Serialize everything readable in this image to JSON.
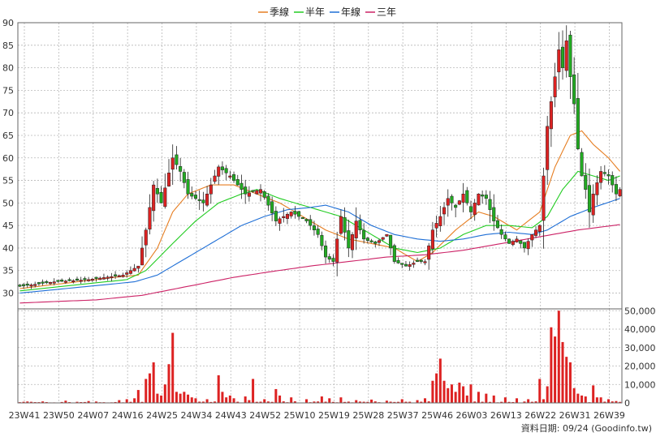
{
  "legend": [
    {
      "label": "季線",
      "color": "#e67e22"
    },
    {
      "label": "半年",
      "color": "#22cc22"
    },
    {
      "label": "年線",
      "color": "#1f6fd6"
    },
    {
      "label": "三年",
      "color": "#cc2266"
    }
  ],
  "source_label": "資料日期: 09/24  (Goodinfo.tw)",
  "colors": {
    "up": "#dd2222",
    "down": "#22aa22",
    "volume": "#dd2222",
    "grid": "#b8b8b8"
  },
  "chart_data": [
    {
      "type": "candlestick",
      "title": "",
      "y_ticks": [
        30,
        35,
        40,
        45,
        50,
        55,
        60,
        65,
        70,
        75,
        80,
        85,
        90
      ],
      "ylim": [
        26.5,
        90
      ],
      "x_ticks": [
        "23W41",
        "23W50",
        "24W07",
        "24W16",
        "24W25",
        "24W34",
        "24W43",
        "24W52",
        "25W10",
        "25W19",
        "25W28",
        "25W37",
        "25W46",
        "26W03",
        "26W13",
        "26W22",
        "26W31",
        "26W39"
      ],
      "x_ticks_note": "one tick per 9 weeks; 158 weekly bars",
      "price_anchors": [
        [
          0,
          31.5
        ],
        [
          9,
          32.5
        ],
        [
          18,
          33
        ],
        [
          27,
          34
        ],
        [
          31,
          36
        ],
        [
          33,
          44
        ],
        [
          35,
          54
        ],
        [
          37,
          50
        ],
        [
          40,
          60
        ],
        [
          42,
          57
        ],
        [
          44,
          52
        ],
        [
          48,
          50
        ],
        [
          52,
          58
        ],
        [
          55,
          56
        ],
        [
          59,
          52
        ],
        [
          63,
          53
        ],
        [
          67,
          46
        ],
        [
          71,
          48
        ],
        [
          75,
          46
        ],
        [
          78,
          43
        ],
        [
          80,
          38
        ],
        [
          82,
          37
        ],
        [
          84,
          47
        ],
        [
          86,
          40
        ],
        [
          88,
          46
        ],
        [
          90,
          42
        ],
        [
          93,
          41
        ],
        [
          96,
          43
        ],
        [
          98,
          37
        ],
        [
          101,
          36
        ],
        [
          104,
          37
        ],
        [
          106,
          37
        ],
        [
          108,
          44
        ],
        [
          110,
          47
        ],
        [
          112,
          51
        ],
        [
          114,
          49
        ],
        [
          116,
          52
        ],
        [
          118,
          48
        ],
        [
          120,
          52
        ],
        [
          122,
          51
        ],
        [
          124,
          46
        ],
        [
          126,
          43
        ],
        [
          128,
          41
        ],
        [
          130,
          42
        ],
        [
          132,
          40
        ],
        [
          134,
          43
        ],
        [
          136,
          45
        ],
        [
          137,
          56
        ],
        [
          138,
          67
        ],
        [
          140,
          78
        ],
        [
          141,
          84
        ],
        [
          142,
          80
        ],
        [
          143,
          86
        ],
        [
          144,
          78
        ],
        [
          145,
          72
        ],
        [
          146,
          62
        ],
        [
          147,
          56
        ],
        [
          148,
          53
        ],
        [
          149,
          48
        ],
        [
          150,
          52
        ],
        [
          152,
          57
        ],
        [
          154,
          56
        ],
        [
          156,
          52
        ],
        [
          157,
          53
        ]
      ],
      "ma_anchors": {
        "季線": [
          [
            0,
            31
          ],
          [
            25,
            33.5
          ],
          [
            31,
            34
          ],
          [
            36,
            40
          ],
          [
            40,
            48
          ],
          [
            44,
            52
          ],
          [
            50,
            54
          ],
          [
            56,
            54
          ],
          [
            62,
            52
          ],
          [
            68,
            50
          ],
          [
            74,
            47
          ],
          [
            80,
            44
          ],
          [
            86,
            42
          ],
          [
            92,
            41
          ],
          [
            98,
            40
          ],
          [
            104,
            37
          ],
          [
            108,
            39
          ],
          [
            114,
            44
          ],
          [
            120,
            48
          ],
          [
            124,
            47
          ],
          [
            130,
            44
          ],
          [
            136,
            48
          ],
          [
            140,
            58
          ],
          [
            144,
            65
          ],
          [
            147,
            66
          ],
          [
            150,
            63
          ],
          [
            154,
            60
          ],
          [
            157,
            57
          ]
        ],
        "半年": [
          [
            0,
            30.5
          ],
          [
            28,
            33
          ],
          [
            33,
            35
          ],
          [
            40,
            41
          ],
          [
            46,
            46
          ],
          [
            52,
            50
          ],
          [
            58,
            52
          ],
          [
            62,
            53
          ],
          [
            68,
            51
          ],
          [
            76,
            49
          ],
          [
            84,
            47
          ],
          [
            92,
            43
          ],
          [
            98,
            40
          ],
          [
            104,
            39
          ],
          [
            110,
            40
          ],
          [
            116,
            43
          ],
          [
            122,
            45
          ],
          [
            128,
            45
          ],
          [
            134,
            44.5
          ],
          [
            138,
            47
          ],
          [
            142,
            53
          ],
          [
            146,
            57
          ],
          [
            150,
            56
          ],
          [
            154,
            55
          ],
          [
            157,
            56
          ]
        ],
        "年線": [
          [
            0,
            30
          ],
          [
            30,
            32.5
          ],
          [
            36,
            34
          ],
          [
            44,
            38
          ],
          [
            52,
            42
          ],
          [
            58,
            45
          ],
          [
            64,
            47
          ],
          [
            70,
            48.5
          ],
          [
            76,
            49
          ],
          [
            80,
            49.5
          ],
          [
            86,
            48
          ],
          [
            92,
            45
          ],
          [
            98,
            43
          ],
          [
            104,
            42
          ],
          [
            110,
            41.5
          ],
          [
            116,
            42
          ],
          [
            122,
            43
          ],
          [
            128,
            43.5
          ],
          [
            134,
            43
          ],
          [
            138,
            44
          ],
          [
            144,
            47
          ],
          [
            150,
            49
          ],
          [
            157,
            51
          ]
        ],
        "三年": [
          [
            0,
            27.8
          ],
          [
            20,
            28.5
          ],
          [
            32,
            29.5
          ],
          [
            44,
            31.5
          ],
          [
            56,
            33.5
          ],
          [
            66,
            34.8
          ],
          [
            76,
            36
          ],
          [
            86,
            37
          ],
          [
            96,
            38
          ],
          [
            106,
            38.5
          ],
          [
            116,
            39.5
          ],
          [
            126,
            41
          ],
          [
            136,
            42.5
          ],
          [
            146,
            44
          ],
          [
            157,
            45.2
          ]
        ]
      }
    },
    {
      "type": "bar",
      "title": "",
      "y_ticks": [
        "0",
        "10,000",
        "20,000",
        "30,000",
        "40,000",
        "50,000"
      ],
      "ylim": [
        0,
        51000
      ],
      "volume_spikes": [
        [
          6,
          800
        ],
        [
          12,
          1200
        ],
        [
          18,
          1000
        ],
        [
          26,
          1500
        ],
        [
          28,
          2000
        ],
        [
          30,
          2500
        ],
        [
          31,
          7000
        ],
        [
          33,
          13000
        ],
        [
          34,
          16000
        ],
        [
          35,
          22000
        ],
        [
          36,
          5000
        ],
        [
          37,
          4000
        ],
        [
          38,
          10000
        ],
        [
          39,
          21000
        ],
        [
          40,
          38000
        ],
        [
          41,
          6000
        ],
        [
          42,
          5000
        ],
        [
          43,
          6000
        ],
        [
          44,
          4500
        ],
        [
          45,
          3000
        ],
        [
          46,
          2500
        ],
        [
          49,
          2000
        ],
        [
          52,
          15000
        ],
        [
          53,
          6000
        ],
        [
          54,
          3000
        ],
        [
          55,
          4000
        ],
        [
          56,
          2500
        ],
        [
          59,
          3500
        ],
        [
          60,
          1500
        ],
        [
          61,
          13000
        ],
        [
          64,
          2000
        ],
        [
          67,
          7500
        ],
        [
          68,
          4000
        ],
        [
          71,
          3000
        ],
        [
          75,
          2000
        ],
        [
          79,
          3500
        ],
        [
          81,
          2500
        ],
        [
          84,
          3000
        ],
        [
          88,
          1500
        ],
        [
          92,
          1800
        ],
        [
          96,
          1200
        ],
        [
          100,
          2000
        ],
        [
          104,
          1500
        ],
        [
          106,
          2500
        ],
        [
          108,
          12000
        ],
        [
          109,
          16000
        ],
        [
          110,
          24000
        ],
        [
          111,
          12000
        ],
        [
          112,
          8000
        ],
        [
          113,
          10000
        ],
        [
          114,
          6000
        ],
        [
          115,
          11000
        ],
        [
          116,
          9000
        ],
        [
          117,
          4000
        ],
        [
          118,
          10000
        ],
        [
          120,
          6000
        ],
        [
          122,
          5000
        ],
        [
          124,
          4000
        ],
        [
          127,
          3000
        ],
        [
          130,
          2500
        ],
        [
          133,
          2000
        ],
        [
          136,
          13000
        ],
        [
          137,
          2000
        ],
        [
          138,
          9000
        ],
        [
          139,
          41000
        ],
        [
          140,
          36000
        ],
        [
          141,
          50000
        ],
        [
          142,
          33000
        ],
        [
          143,
          25000
        ],
        [
          144,
          22000
        ],
        [
          145,
          8000
        ],
        [
          146,
          5000
        ],
        [
          147,
          4000
        ],
        [
          148,
          3500
        ],
        [
          150,
          9500
        ],
        [
          151,
          3000
        ],
        [
          152,
          3000
        ],
        [
          154,
          2000
        ],
        [
          156,
          1000
        ]
      ]
    }
  ]
}
